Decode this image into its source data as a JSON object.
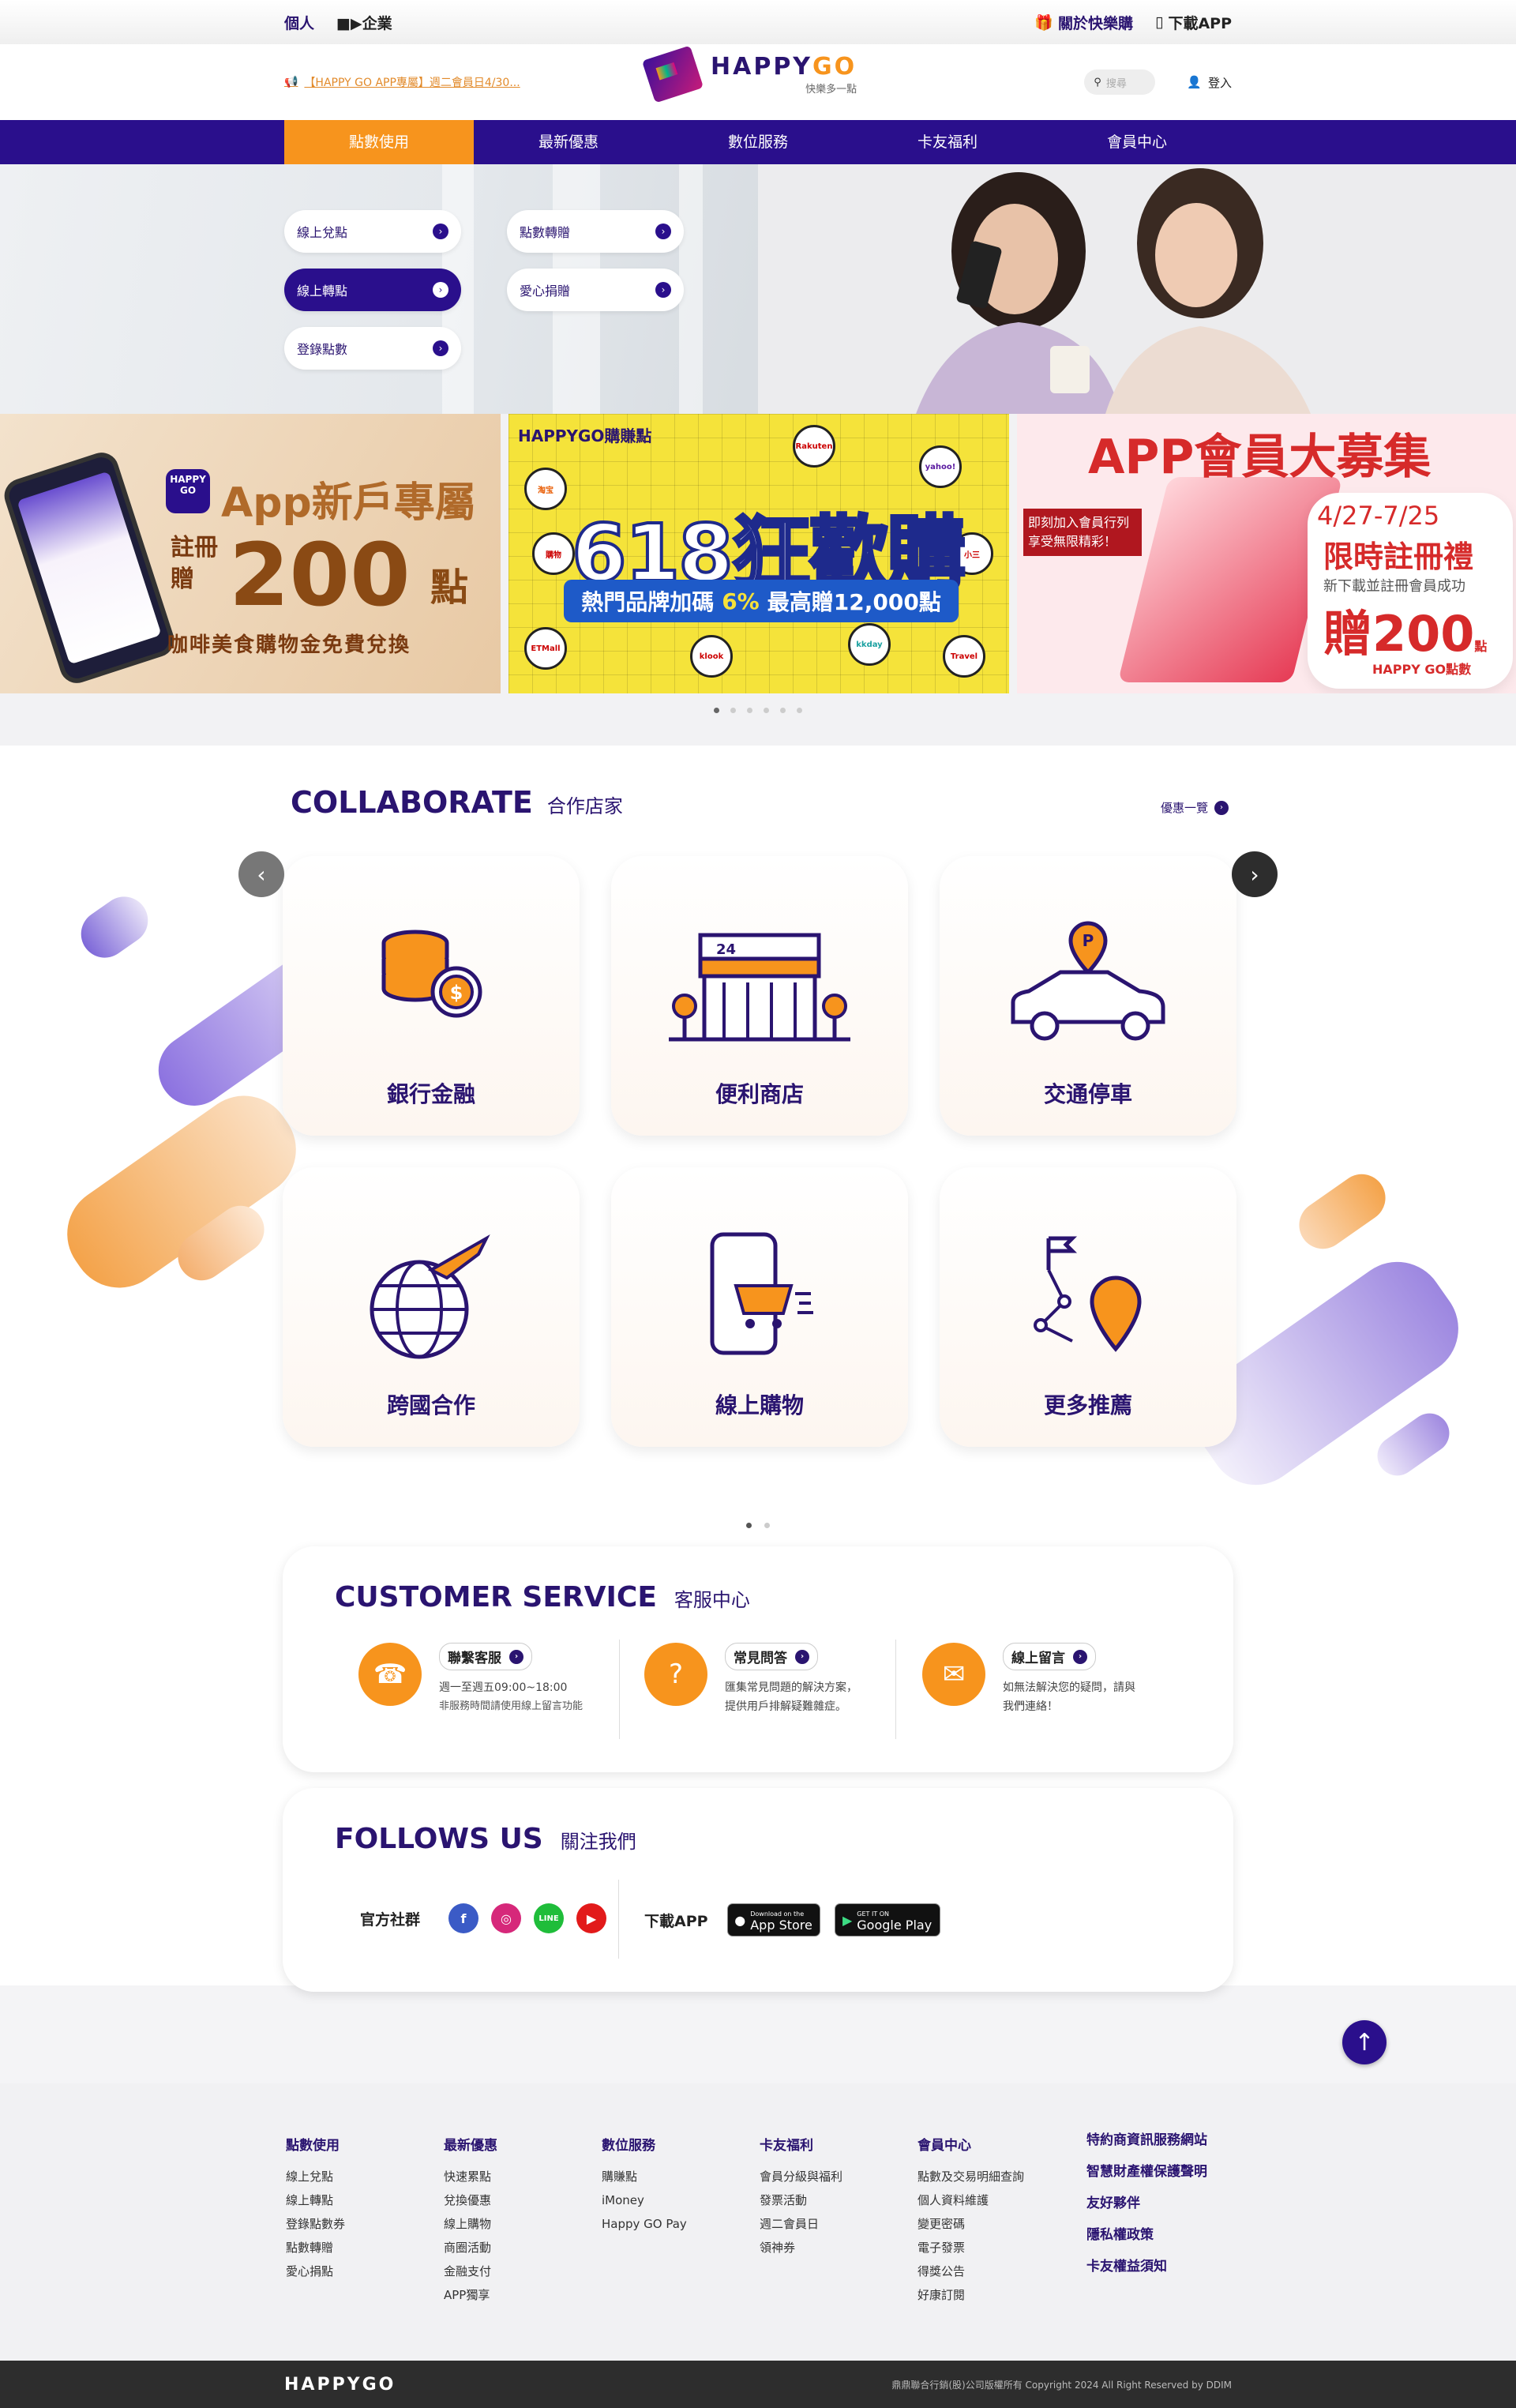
{
  "topbar": {
    "personal": "個人",
    "business": "企業",
    "about": "關於快樂購",
    "download": "下載APP"
  },
  "header": {
    "news": "【HAPPY GO APP專屬】週二會員日4/30...",
    "logo_text": "HAPPYGO",
    "logo_slogan": "快樂多一點",
    "search_placeholder": "搜尋",
    "login": "登入"
  },
  "nav": [
    "點數使用",
    "最新優惠",
    "數位服務",
    "卡友福利",
    "會員中心"
  ],
  "hero": {
    "pills": [
      "線上兌點",
      "點數轉贈",
      "線上轉點",
      "愛心捐贈",
      "登錄點數"
    ]
  },
  "banners": {
    "b1": {
      "go": "HAPPY GO",
      "title": "App新戶專屬",
      "reg": "註冊 贈",
      "num": "200",
      "pt": "點",
      "sub": "咖啡美食購物金免費兌換"
    },
    "b2": {
      "tag": "HAPPYGO購賺點",
      "big": "618狂歡購",
      "bar_a": "熱門品牌加碼",
      "bar_pct": "6%",
      "bar_b": "最高贈12,000點"
    },
    "b3": {
      "title": "APP會員大募集",
      "box": "即刻加入會員行列 享受無限精彩！",
      "date": "4/27-7/25",
      "lim": "限時註冊禮",
      "note": "新下載並註冊會員成功",
      "gift": "贈200",
      "gift_unit": "點",
      "hg": "HAPPY GO點數"
    }
  },
  "collab": {
    "title_en": "COLLABORATE",
    "title_zh": "合作店家",
    "more": "優惠一覽",
    "cards": [
      "銀行金融",
      "便利商店",
      "交通停車",
      "跨國合作",
      "線上購物",
      "更多推薦"
    ]
  },
  "service": {
    "title_en": "CUSTOMER SERVICE",
    "title_zh": "客服中心",
    "items": [
      {
        "btn": "聯繫客服",
        "l1": "週一至週五09:00~18:00",
        "l2": "非服務時間請使用線上留言功能"
      },
      {
        "btn": "常見問答",
        "l1": "匯集常見問題的解決方案，",
        "l2": "提供用戶排解疑難雜症。"
      },
      {
        "btn": "線上留言",
        "l1": "如無法解決您的疑問，請與",
        "l2": "我們連絡！"
      }
    ]
  },
  "follows": {
    "title_en": "FOLLOWS US",
    "title_zh": "關注我們",
    "social_label": "官方社群",
    "download_label": "下載APP",
    "appstore_small": "Download on the",
    "appstore": "App Store",
    "googleplay_small": "GET IT ON",
    "googleplay": "Google Play"
  },
  "footer": {
    "cols": [
      {
        "title": "點數使用",
        "items": [
          "線上兌點",
          "線上轉點",
          "登錄點數券",
          "點數轉贈",
          "愛心捐點"
        ]
      },
      {
        "title": "最新優惠",
        "items": [
          "快速累點",
          "兌換優惠",
          "線上購物",
          "商圈活動",
          "金融支付",
          "APP獨享"
        ]
      },
      {
        "title": "數位服務",
        "items": [
          "購賺點",
          "iMoney",
          "Happy GO Pay"
        ]
      },
      {
        "title": "卡友福利",
        "items": [
          "會員分級與福利",
          "發票活動",
          "週二會員日",
          "領神券"
        ]
      },
      {
        "title": "會員中心",
        "items": [
          "點數及交易明細查詢",
          "個人資料維護",
          "變更密碼",
          "電子發票",
          "得獎公告",
          "好康訂閱"
        ]
      }
    ],
    "links": [
      "特約商資訊服務網站",
      "智慧財產權保護聲明",
      "友好夥伴",
      "隱私權政策",
      "卡友權益須知"
    ],
    "logo": "HAPPYGO",
    "copyright": "鼎鼎聯合行銷(股)公司版權所有 Copyright 2024 All Right Reserved by DDIM"
  }
}
